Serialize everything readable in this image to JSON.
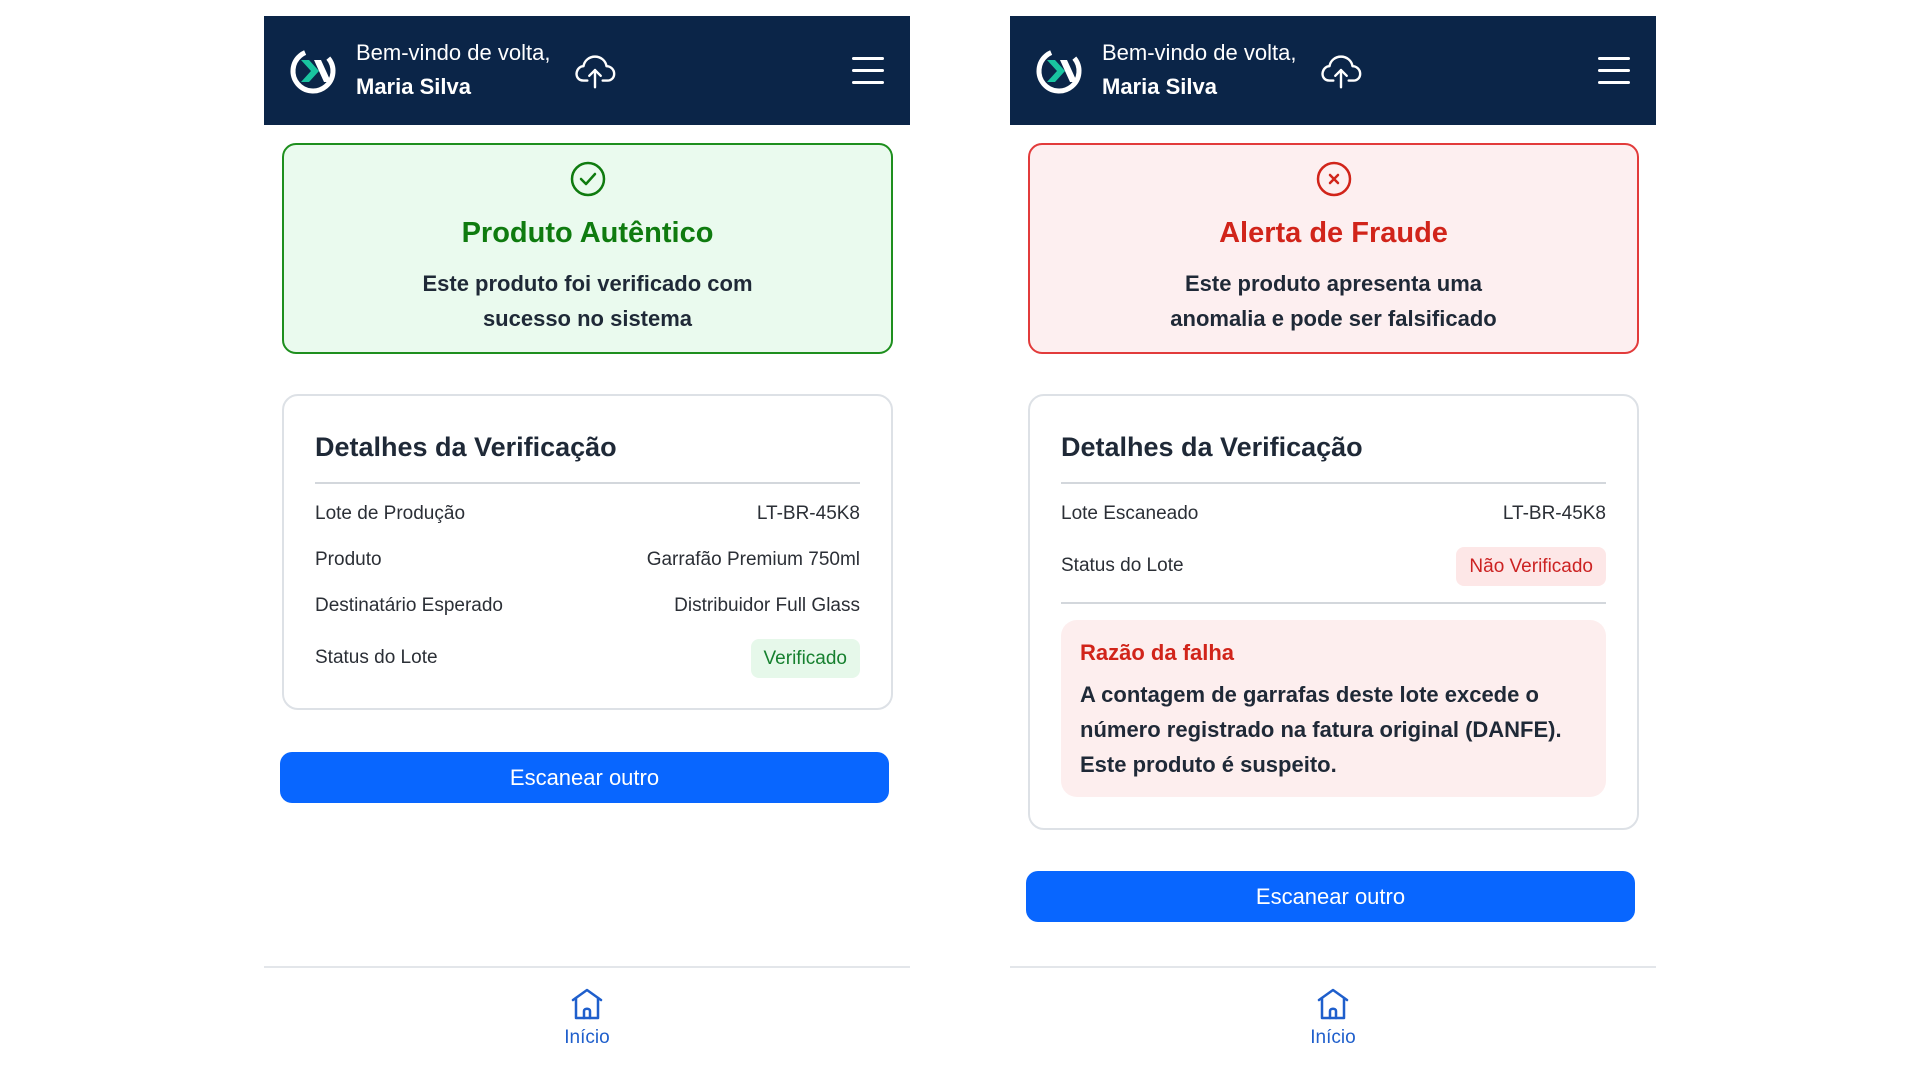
{
  "colors": {
    "header_bg": "#0b2548",
    "primary_button": "#0866ff",
    "success": "#0f7b0f",
    "danger": "#d1241a",
    "nav_active": "#1f5fcc"
  },
  "screens": [
    {
      "header": {
        "greeting": "Bem-vindo de volta,",
        "user_name": "Maria Silva",
        "logo_icon": "logo-icon",
        "upload_icon": "cloud-upload-icon",
        "menu_icon": "hamburger-menu-icon"
      },
      "status": {
        "icon": "check-circle-icon",
        "title": "Produto Autêntico",
        "message_lines": [
          "Este produto foi verificado com",
          "sucesso no sistema"
        ]
      },
      "details": {
        "title": "Detalhes da Verificação",
        "rows": [
          {
            "label": "Lote de Produção",
            "value": "LT-BR-45K8"
          },
          {
            "label": "Produto",
            "value": "Garrafão Premium 750ml"
          },
          {
            "label": "Destinatário Esperado",
            "value": "Distribuidor Full Glass"
          },
          {
            "label": "Status do Lote",
            "value": "Verificado"
          }
        ]
      },
      "scan_button": "Escanear outro",
      "nav": {
        "home_label": "Início",
        "home_icon": "home-icon"
      }
    },
    {
      "header": {
        "greeting": "Bem-vindo de volta,",
        "user_name": "Maria Silva",
        "logo_icon": "logo-icon",
        "upload_icon": "cloud-upload-icon",
        "menu_icon": "hamburger-menu-icon"
      },
      "status": {
        "icon": "x-circle-icon",
        "title": "Alerta de Fraude",
        "message_lines": [
          "Este produto apresenta uma",
          "anomalia e pode ser falsificado"
        ]
      },
      "details": {
        "title": "Detalhes da Verificação",
        "rows": [
          {
            "label": "Lote Escaneado",
            "value": "LT-BR-45K8"
          },
          {
            "label": "Status do Lote",
            "value": "Não Verificado"
          }
        ],
        "failure": {
          "title": "Razão da falha",
          "lines": [
            "A contagem de garrafas deste lote excede o",
            "número registrado na fatura original (DANFE).",
            "Este produto é suspeito."
          ]
        }
      },
      "scan_button": "Escanear outro",
      "nav": {
        "home_label": "Início",
        "home_icon": "home-icon"
      }
    }
  ]
}
